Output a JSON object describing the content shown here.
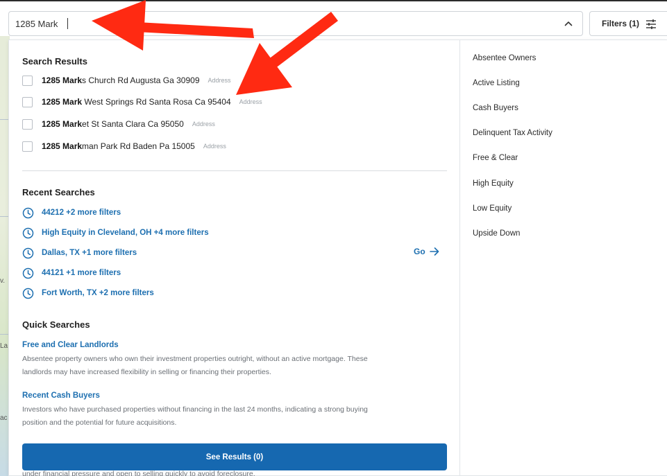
{
  "search": {
    "value": "1285 Mark",
    "chevron_icon": "chevron-up-icon"
  },
  "filters_button": {
    "label": "Filters (1)",
    "icon": "sliders-icon"
  },
  "search_results": {
    "title": "Search Results",
    "items": [
      {
        "bold": "1285 Mark",
        "rest": "s Church Rd Augusta Ga 30909",
        "tag": "Address"
      },
      {
        "bold": "1285 Mark",
        "rest": " West Springs Rd Santa Rosa Ca 95404",
        "tag": "Address"
      },
      {
        "bold": "1285 Mark",
        "rest": "et St Santa Clara Ca 95050",
        "tag": "Address"
      },
      {
        "bold": "1285 Mark",
        "rest": "man Park Rd Baden Pa 15005",
        "tag": "Address"
      }
    ]
  },
  "recent_searches": {
    "title": "Recent Searches",
    "items": [
      {
        "label": "44212 +2 more filters"
      },
      {
        "label": "High Equity in Cleveland, OH +4 more filters"
      },
      {
        "label": "Dallas, TX +1 more filters"
      },
      {
        "label": "44121 +1 more filters"
      },
      {
        "label": "Fort Worth, TX +2 more filters"
      }
    ],
    "go_label": "Go"
  },
  "quick_searches": {
    "title": "Quick Searches",
    "items": [
      {
        "title": "Free and Clear Landlords",
        "description": "Absentee property owners who own their investment properties outright, without an active mortgage. These landlords may have increased flexibility in selling or financing their properties."
      },
      {
        "title": "Recent Cash Buyers",
        "description": "Investors who have purchased properties without financing in the last 24 months, indicating a strong buying position and the potential for future acquisitions."
      }
    ],
    "cut_off_text": "under financial pressure and open to selling quickly to avoid foreclosure."
  },
  "see_results": {
    "label": "See Results (0)"
  },
  "right_filters": [
    "Absentee Owners",
    "Active Listing",
    "Cash Buyers",
    "Delinquent Tax Activity",
    "Free & Clear",
    "High Equity",
    "Low Equity",
    "Upside Down"
  ],
  "map_fragments": [
    "v.",
    "La",
    "ac"
  ],
  "colors": {
    "accent": "#1d6fb0",
    "button": "#1668b0",
    "annotation_arrow": "#ff2a12"
  }
}
